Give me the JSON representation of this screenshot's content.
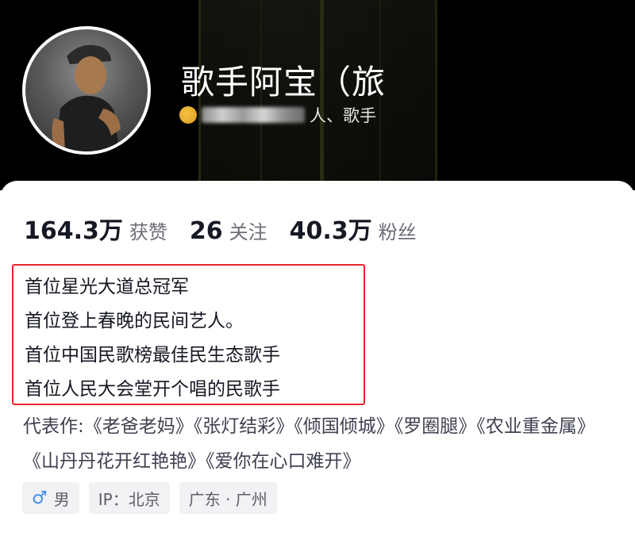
{
  "profile": {
    "name": "歌手阿宝（旅",
    "subtitle": "人、歌手"
  },
  "stats": [
    {
      "value": "164.3万",
      "label": "获赞"
    },
    {
      "value": "26",
      "label": "关注"
    },
    {
      "value": "40.3万",
      "label": "粉丝"
    }
  ],
  "bio": {
    "lines": [
      "首位星光大道总冠军",
      "首位登上春晚的民间艺人。",
      "首位中国民歌榜最佳民生态歌手",
      "首位人民大会堂开个唱的民歌手"
    ],
    "works": "代表作:《老爸老妈》《张灯结彩》《倾国倾城》《罗圈腿》《农业重金属》 《山丹丹花开红艳艳》《爱你在心口难开》"
  },
  "tags": {
    "gender_icon": "♂",
    "gender": "男",
    "ip": "IP：北京",
    "location": "广东 · 广州"
  },
  "colors": {
    "highlight": "#e8262b",
    "male": "#3d8ef0"
  }
}
